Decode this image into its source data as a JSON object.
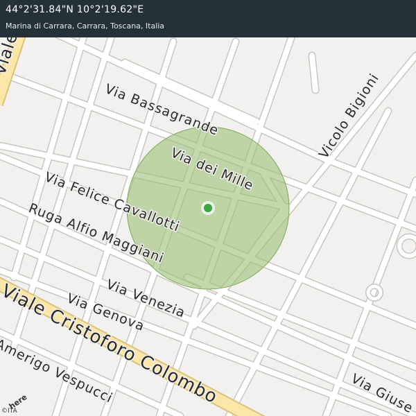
{
  "header": {
    "coordinates": "44°2'31.84\"N 10°2'19.62\"E",
    "place": "Marina di Carrara, Carrara, Toscana, Italia"
  },
  "streets": {
    "via_bassagrande": "Via  Bassagrande",
    "via_dei_mille": "Via  dei  Mille",
    "vicolo_bigioni": "Vicolo  Bigioni",
    "via_felice_cavallotti": "Via  Felice  Cavallotti",
    "ruga_alfio_maggiani": "Ruga  Alfio  Maggiani",
    "via_venezia": "Via  Venezia",
    "via_genova": "Via  Genova",
    "viale_cristoforo_colombo": "Viale  Cristoforo  Colombo",
    "amerigo_vespucci": "Amerigo  Vespucci",
    "via_giuse": "Via  Giuse",
    "viale_top": "Viale"
  },
  "attribution": {
    "logo": "here",
    "copyright": "©ITA"
  },
  "colors": {
    "background": "#f2f1ef",
    "road": "#ffffff",
    "road_outline": "#c9c6c0",
    "major_road": "#fbe6a8",
    "accuracy_circle": "#9bbf74",
    "location_dot": "#3aa847",
    "header": "#243139"
  }
}
